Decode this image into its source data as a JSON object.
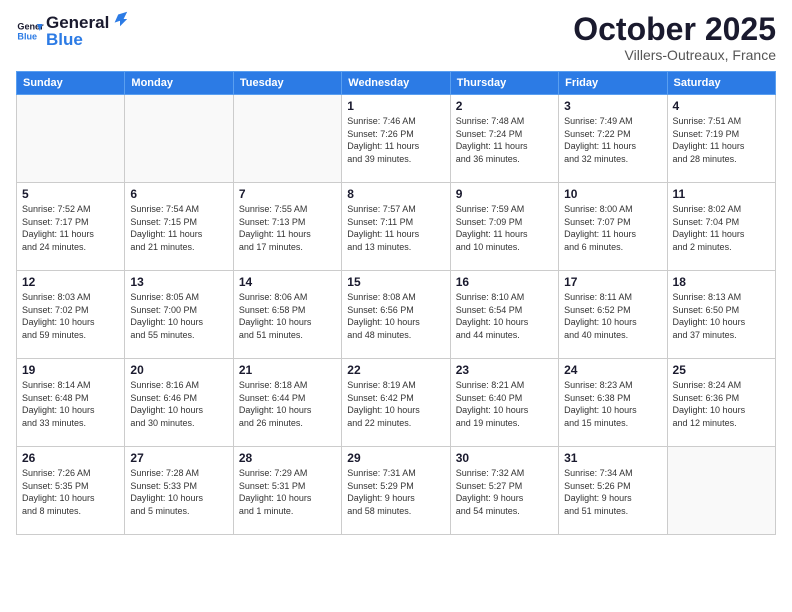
{
  "logo": {
    "line1": "General",
    "line2": "Blue"
  },
  "title": "October 2025",
  "subtitle": "Villers-Outreaux, France",
  "weekdays": [
    "Sunday",
    "Monday",
    "Tuesday",
    "Wednesday",
    "Thursday",
    "Friday",
    "Saturday"
  ],
  "weeks": [
    [
      {
        "day": "",
        "info": ""
      },
      {
        "day": "",
        "info": ""
      },
      {
        "day": "",
        "info": ""
      },
      {
        "day": "1",
        "info": "Sunrise: 7:46 AM\nSunset: 7:26 PM\nDaylight: 11 hours\nand 39 minutes."
      },
      {
        "day": "2",
        "info": "Sunrise: 7:48 AM\nSunset: 7:24 PM\nDaylight: 11 hours\nand 36 minutes."
      },
      {
        "day": "3",
        "info": "Sunrise: 7:49 AM\nSunset: 7:22 PM\nDaylight: 11 hours\nand 32 minutes."
      },
      {
        "day": "4",
        "info": "Sunrise: 7:51 AM\nSunset: 7:19 PM\nDaylight: 11 hours\nand 28 minutes."
      }
    ],
    [
      {
        "day": "5",
        "info": "Sunrise: 7:52 AM\nSunset: 7:17 PM\nDaylight: 11 hours\nand 24 minutes."
      },
      {
        "day": "6",
        "info": "Sunrise: 7:54 AM\nSunset: 7:15 PM\nDaylight: 11 hours\nand 21 minutes."
      },
      {
        "day": "7",
        "info": "Sunrise: 7:55 AM\nSunset: 7:13 PM\nDaylight: 11 hours\nand 17 minutes."
      },
      {
        "day": "8",
        "info": "Sunrise: 7:57 AM\nSunset: 7:11 PM\nDaylight: 11 hours\nand 13 minutes."
      },
      {
        "day": "9",
        "info": "Sunrise: 7:59 AM\nSunset: 7:09 PM\nDaylight: 11 hours\nand 10 minutes."
      },
      {
        "day": "10",
        "info": "Sunrise: 8:00 AM\nSunset: 7:07 PM\nDaylight: 11 hours\nand 6 minutes."
      },
      {
        "day": "11",
        "info": "Sunrise: 8:02 AM\nSunset: 7:04 PM\nDaylight: 11 hours\nand 2 minutes."
      }
    ],
    [
      {
        "day": "12",
        "info": "Sunrise: 8:03 AM\nSunset: 7:02 PM\nDaylight: 10 hours\nand 59 minutes."
      },
      {
        "day": "13",
        "info": "Sunrise: 8:05 AM\nSunset: 7:00 PM\nDaylight: 10 hours\nand 55 minutes."
      },
      {
        "day": "14",
        "info": "Sunrise: 8:06 AM\nSunset: 6:58 PM\nDaylight: 10 hours\nand 51 minutes."
      },
      {
        "day": "15",
        "info": "Sunrise: 8:08 AM\nSunset: 6:56 PM\nDaylight: 10 hours\nand 48 minutes."
      },
      {
        "day": "16",
        "info": "Sunrise: 8:10 AM\nSunset: 6:54 PM\nDaylight: 10 hours\nand 44 minutes."
      },
      {
        "day": "17",
        "info": "Sunrise: 8:11 AM\nSunset: 6:52 PM\nDaylight: 10 hours\nand 40 minutes."
      },
      {
        "day": "18",
        "info": "Sunrise: 8:13 AM\nSunset: 6:50 PM\nDaylight: 10 hours\nand 37 minutes."
      }
    ],
    [
      {
        "day": "19",
        "info": "Sunrise: 8:14 AM\nSunset: 6:48 PM\nDaylight: 10 hours\nand 33 minutes."
      },
      {
        "day": "20",
        "info": "Sunrise: 8:16 AM\nSunset: 6:46 PM\nDaylight: 10 hours\nand 30 minutes."
      },
      {
        "day": "21",
        "info": "Sunrise: 8:18 AM\nSunset: 6:44 PM\nDaylight: 10 hours\nand 26 minutes."
      },
      {
        "day": "22",
        "info": "Sunrise: 8:19 AM\nSunset: 6:42 PM\nDaylight: 10 hours\nand 22 minutes."
      },
      {
        "day": "23",
        "info": "Sunrise: 8:21 AM\nSunset: 6:40 PM\nDaylight: 10 hours\nand 19 minutes."
      },
      {
        "day": "24",
        "info": "Sunrise: 8:23 AM\nSunset: 6:38 PM\nDaylight: 10 hours\nand 15 minutes."
      },
      {
        "day": "25",
        "info": "Sunrise: 8:24 AM\nSunset: 6:36 PM\nDaylight: 10 hours\nand 12 minutes."
      }
    ],
    [
      {
        "day": "26",
        "info": "Sunrise: 7:26 AM\nSunset: 5:35 PM\nDaylight: 10 hours\nand 8 minutes."
      },
      {
        "day": "27",
        "info": "Sunrise: 7:28 AM\nSunset: 5:33 PM\nDaylight: 10 hours\nand 5 minutes."
      },
      {
        "day": "28",
        "info": "Sunrise: 7:29 AM\nSunset: 5:31 PM\nDaylight: 10 hours\nand 1 minute."
      },
      {
        "day": "29",
        "info": "Sunrise: 7:31 AM\nSunset: 5:29 PM\nDaylight: 9 hours\nand 58 minutes."
      },
      {
        "day": "30",
        "info": "Sunrise: 7:32 AM\nSunset: 5:27 PM\nDaylight: 9 hours\nand 54 minutes."
      },
      {
        "day": "31",
        "info": "Sunrise: 7:34 AM\nSunset: 5:26 PM\nDaylight: 9 hours\nand 51 minutes."
      },
      {
        "day": "",
        "info": ""
      }
    ]
  ]
}
